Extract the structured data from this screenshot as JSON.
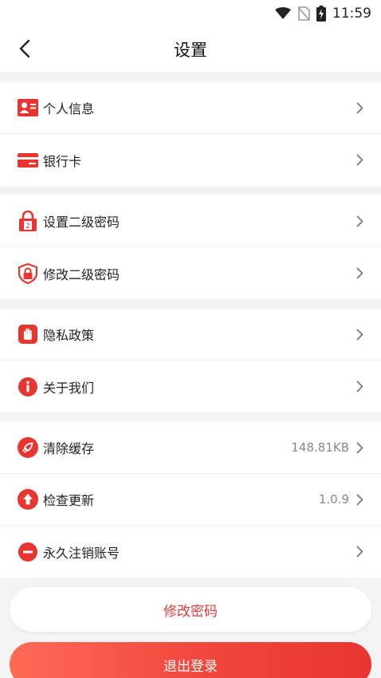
{
  "status_bar": {
    "time": "11:59",
    "icons": [
      "wifi-icon",
      "no-sim-icon",
      "battery-charging-icon"
    ]
  },
  "header": {
    "title": "设置",
    "back_icon": "back-chevron-icon"
  },
  "groups": [
    {
      "items": [
        {
          "label": "个人信息",
          "icon": "id-card-icon",
          "value": ""
        },
        {
          "label": "银行卡",
          "icon": "bank-card-icon",
          "value": ""
        }
      ]
    },
    {
      "items": [
        {
          "label": "设置二级密码",
          "icon": "lock-icon",
          "value": ""
        },
        {
          "label": "修改二级密码",
          "icon": "shield-lock-icon",
          "value": ""
        }
      ]
    },
    {
      "items": [
        {
          "label": "隐私政策",
          "icon": "hand-icon",
          "value": ""
        },
        {
          "label": "关于我们",
          "icon": "info-icon",
          "value": ""
        }
      ]
    },
    {
      "items": [
        {
          "label": "清除缓存",
          "icon": "rocket-icon",
          "value": "148.81KB"
        },
        {
          "label": "检查更新",
          "icon": "update-arrow-icon",
          "value": "1.0.9"
        },
        {
          "label": "永久注销账号",
          "icon": "minus-circle-icon",
          "value": ""
        }
      ]
    }
  ],
  "buttons": {
    "change_password": "修改密码",
    "logout": "退出登录"
  },
  "colors": {
    "accent": "#e8352f",
    "gradient_start": "#ff6a55"
  }
}
